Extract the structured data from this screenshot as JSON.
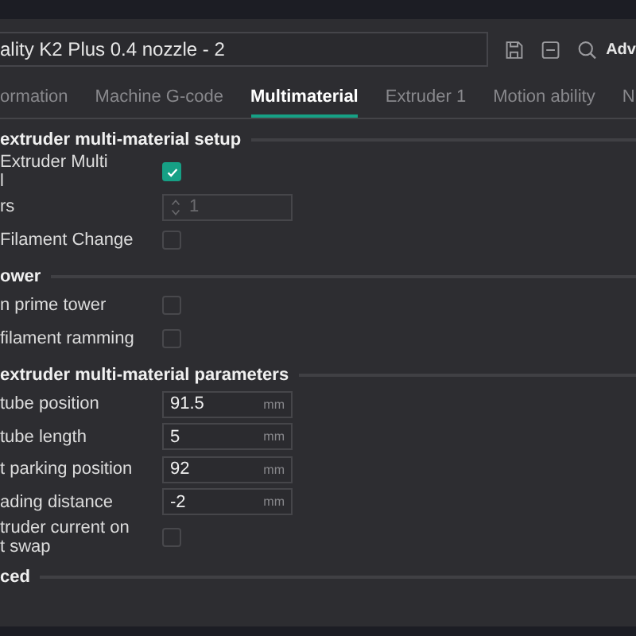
{
  "preset": {
    "value": "ality K2 Plus 0.4 nozzle - 2",
    "advanced_label": "Adv"
  },
  "tabs": [
    {
      "label": "ormation",
      "selected": false
    },
    {
      "label": "Machine G-code",
      "selected": false
    },
    {
      "label": "Multimaterial",
      "selected": true
    },
    {
      "label": "Extruder 1",
      "selected": false
    },
    {
      "label": "Motion ability",
      "selected": false
    },
    {
      "label": "N",
      "selected": false
    }
  ],
  "sections": [
    {
      "title": "extruder multi-material setup",
      "rows": [
        {
          "kind": "checkbox",
          "label": "Extruder Multi\nl",
          "checked": true
        },
        {
          "kind": "spin",
          "label": "rs",
          "value": "1",
          "disabled": true
        },
        {
          "kind": "checkbox",
          "label": " Filament Change",
          "checked": false
        }
      ]
    },
    {
      "title": "ower",
      "rows": [
        {
          "kind": "checkbox",
          "label": "n prime tower",
          "checked": false
        },
        {
          "kind": "checkbox",
          "label": "filament ramming",
          "checked": false
        }
      ]
    },
    {
      "title": "extruder multi-material parameters",
      "rows": [
        {
          "kind": "number",
          "label": " tube position",
          "value": "91.5",
          "unit": "mm"
        },
        {
          "kind": "number",
          "label": " tube length",
          "value": "5",
          "unit": "mm"
        },
        {
          "kind": "number",
          "label": "t parking position",
          "value": "92",
          "unit": "mm"
        },
        {
          "kind": "number",
          "label": "ading distance",
          "value": "-2",
          "unit": "mm"
        },
        {
          "kind": "checkbox",
          "label": "truder current on\nt swap",
          "checked": false
        }
      ]
    },
    {
      "title": "ced"
    }
  ]
}
